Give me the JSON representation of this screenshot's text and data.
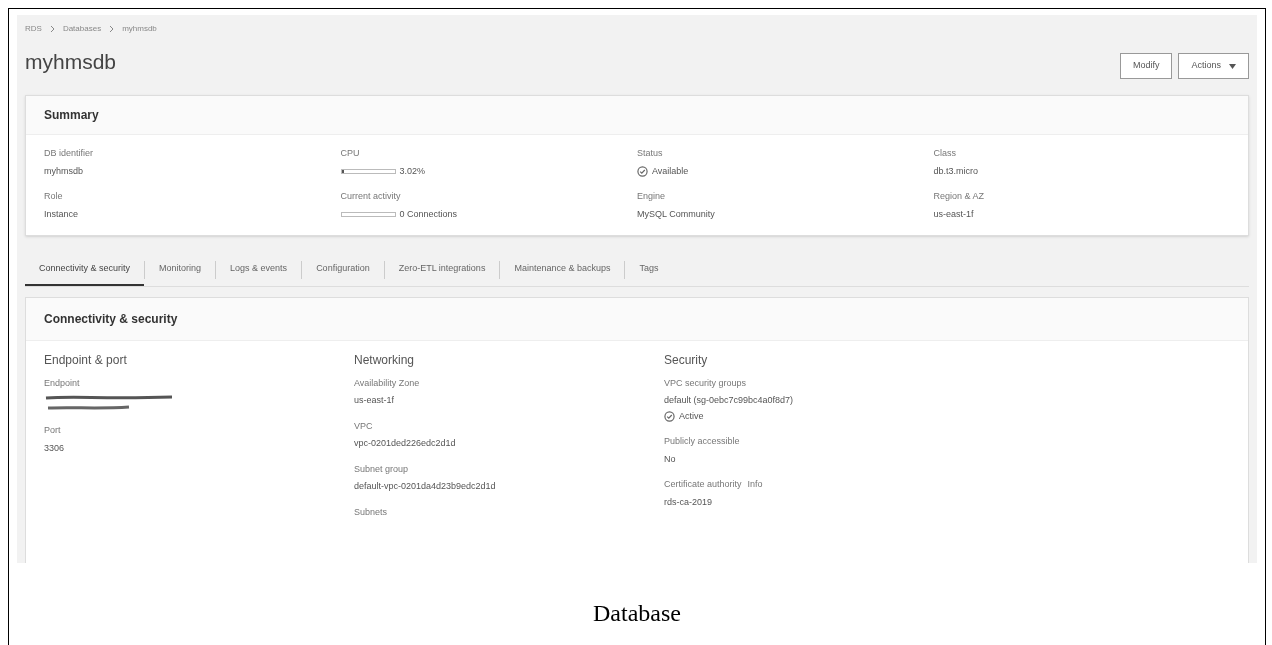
{
  "breadcrumbs": [
    "RDS",
    "Databases",
    "myhmsdb"
  ],
  "title": "myhmsdb",
  "buttons": [
    {
      "label": "Modify",
      "kind": "plain"
    },
    {
      "label": "Actions",
      "kind": "dropdown"
    }
  ],
  "summary": {
    "heading": "Summary",
    "fields": [
      {
        "label": "DB identifier",
        "value": "myhmsdb",
        "kind": "text"
      },
      {
        "label": "CPU",
        "value": "3.02%",
        "kind": "meter",
        "level": 0.05
      },
      {
        "label": "Status",
        "value": "Available",
        "kind": "status"
      },
      {
        "label": "Class",
        "value": "db.t3.micro",
        "kind": "text"
      },
      {
        "label": "Role",
        "value": "Instance",
        "kind": "text"
      },
      {
        "label": "Current activity",
        "value": "0 Connections",
        "kind": "meter",
        "level": 0
      },
      {
        "label": "Engine",
        "value": "MySQL Community",
        "kind": "text"
      },
      {
        "label": "Region & AZ",
        "value": "us-east-1f",
        "kind": "text"
      }
    ]
  },
  "tabs": [
    {
      "label": "Connectivity & security",
      "selected": true
    },
    {
      "label": "Monitoring",
      "selected": false
    },
    {
      "label": "Logs & events",
      "selected": false
    },
    {
      "label": "Configuration",
      "selected": false
    },
    {
      "label": "Zero-ETL integrations",
      "selected": false
    },
    {
      "label": "Maintenance & backups",
      "selected": false
    },
    {
      "label": "Tags",
      "selected": false
    }
  ],
  "connectivity": {
    "heading": "Connectivity & security",
    "columns": [
      {
        "heading": "Endpoint & port",
        "fields": [
          {
            "label": "Endpoint",
            "kind": "redacted"
          },
          {
            "label": "Port",
            "value": "3306",
            "kind": "text"
          }
        ]
      },
      {
        "heading": "Networking",
        "fields": [
          {
            "label": "Availability Zone",
            "value": "us-east-1f",
            "kind": "text"
          },
          {
            "label": "VPC",
            "value": "vpc-0201ded226edc2d1d",
            "kind": "text"
          },
          {
            "label": "Subnet group",
            "value": "default-vpc-0201da4d23b9edc2d1d",
            "kind": "text"
          },
          {
            "label": "Subnets",
            "kind": "label"
          }
        ]
      },
      {
        "heading": "Security",
        "fields": [
          {
            "label": "VPC security groups",
            "value": "default (sg-0ebc7c99bc4a0f8d7)",
            "kind": "status",
            "status": "Active"
          },
          {
            "label": "Publicly accessible",
            "value": "No",
            "kind": "text"
          },
          {
            "label": "Certificate authority",
            "info": "Info",
            "value": "rds-ca-2019",
            "kind": "text"
          }
        ]
      }
    ]
  },
  "caption": "Database"
}
